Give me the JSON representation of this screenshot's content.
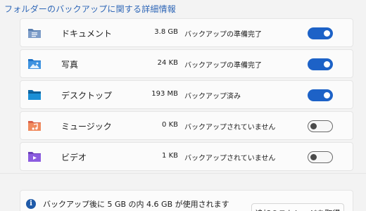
{
  "section": {
    "title": "フォルダーのバックアップに関する詳細情報"
  },
  "folders": [
    {
      "name": "ドキュメント",
      "size": "3.8 GB",
      "status": "バックアップの準備完了",
      "toggle": "on",
      "icon": "documents-folder-icon"
    },
    {
      "name": "写真",
      "size": "24 KB",
      "status": "バックアップの準備完了",
      "toggle": "on",
      "icon": "pictures-folder-icon"
    },
    {
      "name": "デスクトップ",
      "size": "193 MB",
      "status": "バックアップ済み",
      "toggle": "on",
      "icon": "desktop-folder-icon"
    },
    {
      "name": "ミュージック",
      "size": "0 KB",
      "status": "バックアップされていません",
      "toggle": "off",
      "icon": "music-folder-icon"
    },
    {
      "name": "ビデオ",
      "size": "1 KB",
      "status": "バックアップされていません",
      "toggle": "off",
      "icon": "videos-folder-icon"
    }
  ],
  "info": {
    "icon": "info-icon",
    "text": "バックアップ後に 5 GB の内 4.6 GB が使用されます",
    "button_label": "追加のストレージを取得"
  },
  "colors": {
    "accent": "#1d62c7",
    "title": "#2f67b7"
  }
}
